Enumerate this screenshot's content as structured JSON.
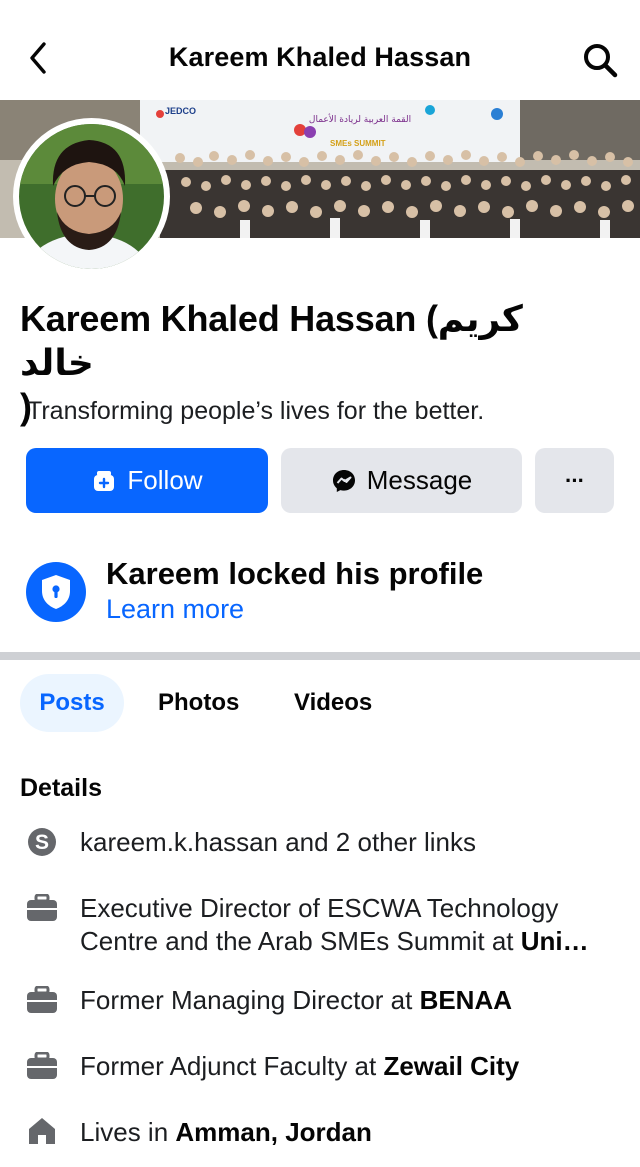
{
  "header": {
    "title": "Kareem Khaled Hassan"
  },
  "cover": {
    "event_logo": "JEDCO",
    "banner_text_ar": "القمة العربية لريادة الأعمال",
    "banner_text_en": "SMEs SUMMIT"
  },
  "profile": {
    "name_en": "Kareem Khaled Hassan (",
    "name_ar": "كريم خالد",
    "name_close": ")",
    "bio": "Transforming people’s lives for the better."
  },
  "actions": {
    "follow_label": "Follow",
    "message_label": "Message",
    "more_label": "···"
  },
  "lock_notice": {
    "title": "Kareem locked his profile",
    "link": "Learn more"
  },
  "tabs": [
    {
      "label": "Posts",
      "active": true
    },
    {
      "label": "Photos",
      "active": false
    },
    {
      "label": "Videos",
      "active": false
    }
  ],
  "details": {
    "title": "Details",
    "skype": {
      "icon": "skype-icon",
      "text": "kareem.k.hassan and 2 other links"
    },
    "job1": {
      "icon": "briefcase-icon",
      "line1": "Executive Director of ESCWA Technology",
      "line2_prefix": "Centre and the Arab SMEs Summit at ",
      "line2_bold": "Uni…"
    },
    "job2": {
      "icon": "briefcase-icon",
      "prefix": "Former Managing Director at ",
      "bold": "BENAA"
    },
    "job3": {
      "icon": "briefcase-icon",
      "prefix": "Former Adjunct Faculty at ",
      "bold": "Zewail City"
    },
    "home": {
      "icon": "home-icon",
      "prefix": "Lives in ",
      "bold": "Amman, Jordan"
    }
  },
  "colors": {
    "accent": "#0866ff",
    "button_gray": "#e4e6eb",
    "tab_active_bg": "#ebf5ff",
    "icon_gray": "#65676b"
  }
}
